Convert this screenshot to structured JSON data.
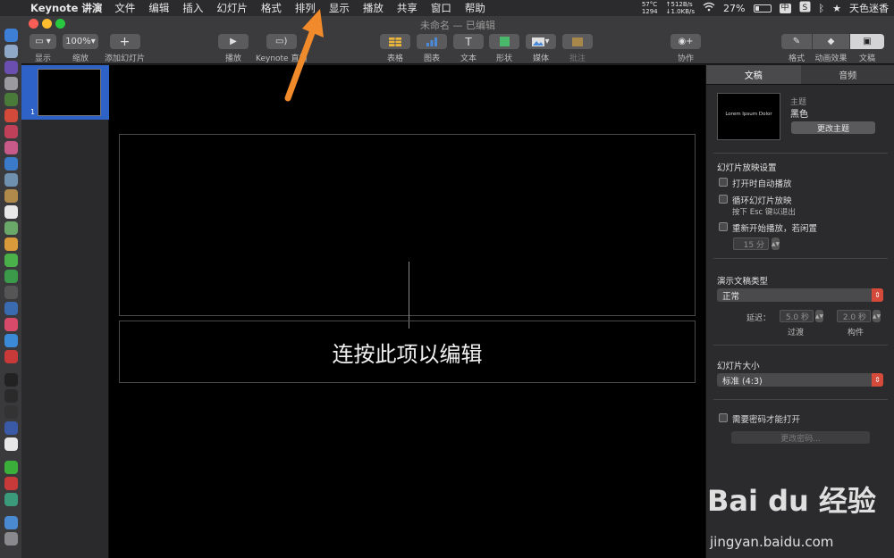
{
  "menubar": {
    "app_name": "Keynote 讲演",
    "items": [
      "文件",
      "编辑",
      "插入",
      "幻灯片",
      "格式",
      "排列",
      "显示",
      "播放",
      "共享",
      "窗口",
      "帮助"
    ],
    "temp": "57°C",
    "fan": "1294",
    "net_up": "↑512B/s",
    "net_down": "↓1.0KB/s",
    "battery": "27%",
    "battery_level": 0.27,
    "input_method": "中",
    "user": "天色迷香"
  },
  "window": {
    "title": "未命名 — 已编辑"
  },
  "toolbar": {
    "view_label": "显示",
    "zoom_value": "100%",
    "zoom_label": "缩放",
    "add_slide_label": "添加幻灯片",
    "play_label": "播放",
    "keynote_live_label": "Keynote 直播",
    "table_label": "表格",
    "chart_label": "图表",
    "text_label": "文本",
    "shape_label": "形状",
    "media_label": "媒体",
    "comment_label": "批注",
    "collaborate_label": "协作",
    "format_label": "格式",
    "animate_label": "动画效果",
    "document_label": "文稿"
  },
  "navigator": {
    "slide_number": "1"
  },
  "canvas": {
    "placeholder_text": "连按此项以编辑"
  },
  "inspector": {
    "tabs": [
      "文稿",
      "音频"
    ],
    "theme_thumb_text": "Lorem Ipsum Dolor",
    "theme_label": "主题",
    "theme_name": "黑色",
    "change_theme": "更改主题",
    "slideshow_settings_title": "幻灯片放映设置",
    "autoplay": "打开时自动播放",
    "loop": "循环幻灯片放映",
    "loop_hint": "按下 Esc 键以退出",
    "restart_idle": "重新开始播放，若闲置",
    "idle_value": "15 分",
    "presentation_type_title": "演示文稿类型",
    "presentation_type_value": "正常",
    "delay_label": "延迟：",
    "transition_value": "5.0 秒",
    "build_value": "2.0 秒",
    "transition_label": "过渡",
    "build_label": "构件",
    "slide_size_title": "幻灯片大小",
    "slide_size_value": "标准 (4:3)",
    "require_password": "需要密码才能打开",
    "change_password": "更改密码..."
  },
  "watermark": {
    "logo": "Bai du 经验",
    "url": "jingyan.baidu.com"
  },
  "colors": {
    "accent_blue": "#2f62c6",
    "popup_red": "#d54a3b",
    "arrow_orange": "#f08a2b"
  }
}
